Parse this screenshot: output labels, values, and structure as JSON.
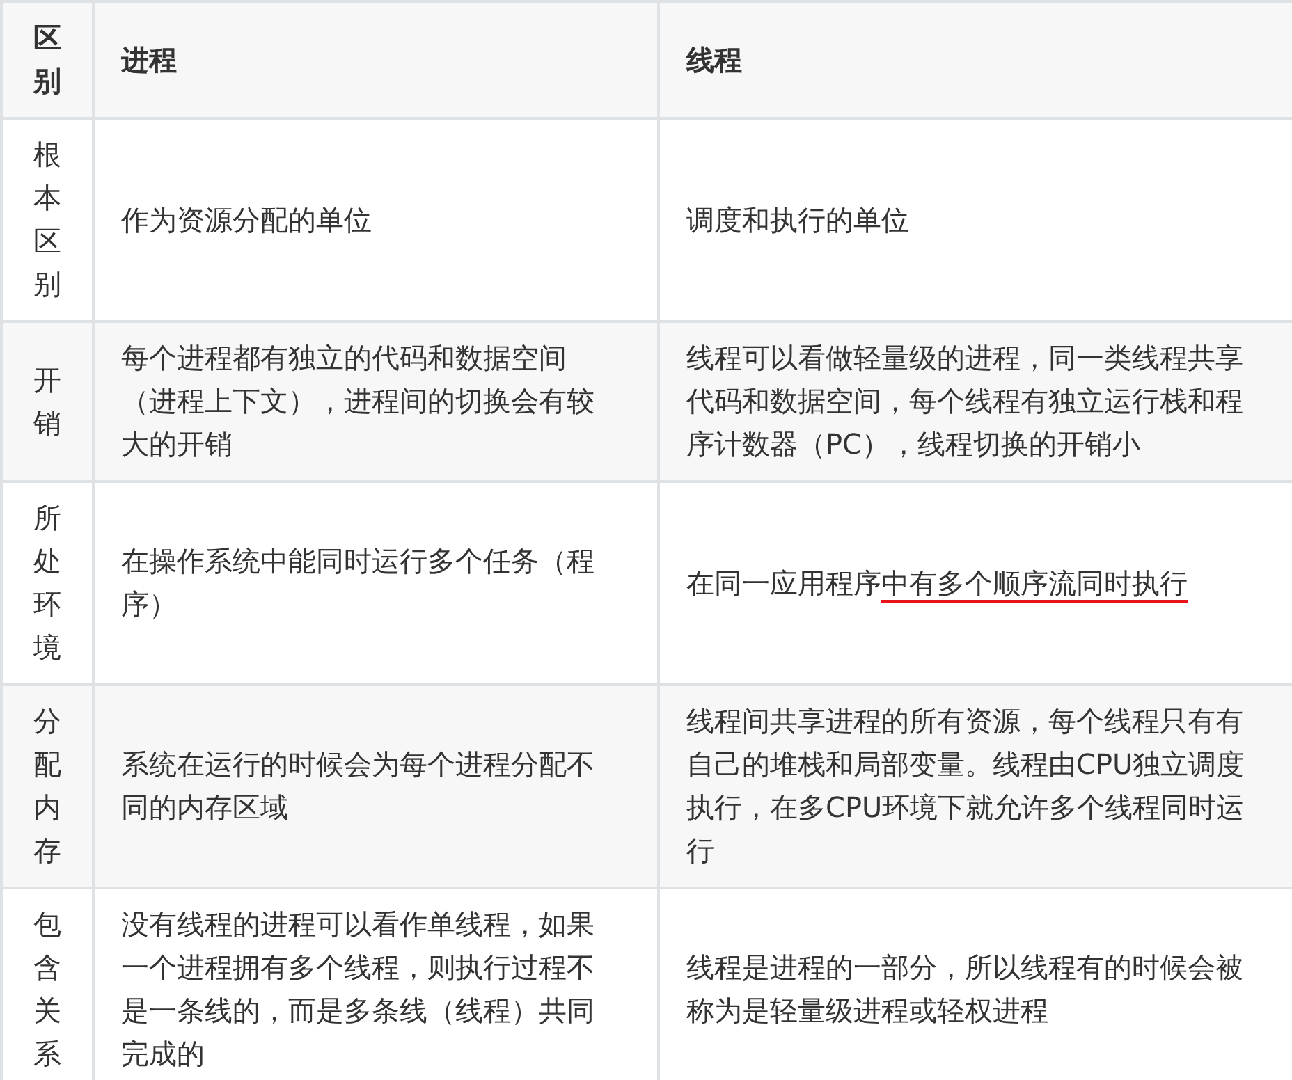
{
  "table": {
    "columns": [
      {
        "label": "区别"
      },
      {
        "label": "进程"
      },
      {
        "label": "线程"
      }
    ],
    "rows": [
      {
        "cells": [
          "根本区别",
          "作为资源分配的单位",
          "调度和执行的单位"
        ]
      },
      {
        "cells": [
          "开销",
          "每个进程都有独立的代码和数据空间（进程上下文），进程间的切换会有较大的开销",
          "线程可以看做轻量级的进程，同一类线程共享代码和数据空间，每个线程有独立运行栈和程序计数器（PC），线程切换的开销小"
        ]
      },
      {
        "cells": [
          "所处环境",
          "在操作系统中能同时运行多个任务（程序）",
          {
            "segments": [
              {
                "text": "在同一应用程序",
                "underline": false
              },
              {
                "text": "中有多个顺序流同时执行",
                "underline": true
              }
            ]
          }
        ]
      },
      {
        "cells": [
          "分配内存",
          "系统在运行的时候会为每个进程分配不同的内存区域",
          "线程间共享进程的所有资源，每个线程只有有自己的堆栈和局部变量。线程由CPU独立调度执行，在多CPU环境下就允许多个线程同时运行"
        ]
      },
      {
        "cells": [
          "包含关系",
          "没有线程的进程可以看作单线程，如果一个进程拥有多个线程，则执行过程不是一条线的，而是多条线（线程）共同完成的",
          "线程是进程的一部分，所以线程有的时候会被称为是轻量级进程或轻权进程"
        ]
      }
    ]
  }
}
